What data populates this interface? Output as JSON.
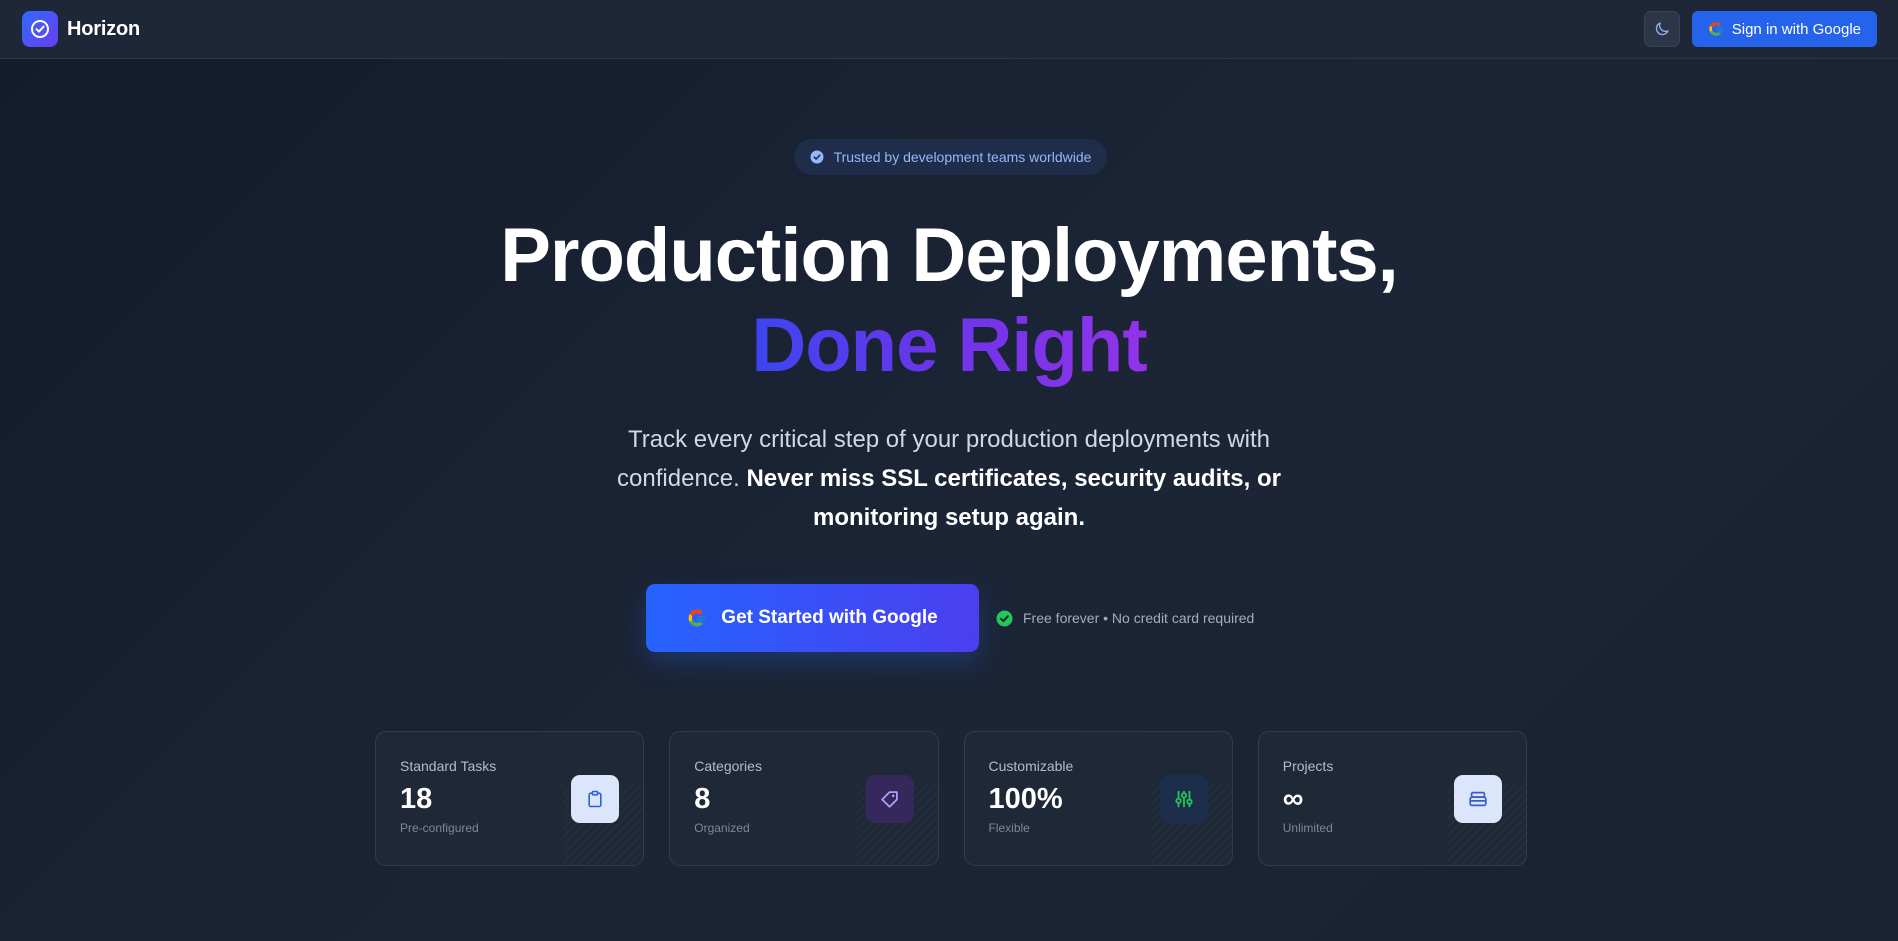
{
  "nav": {
    "brand": "Horizon",
    "signin_label": "Sign in with Google"
  },
  "hero": {
    "badge": "Trusted by development teams worldwide",
    "title_line1": "Production Deployments,",
    "title_line2": "Done Right",
    "subtitle_plain": "Track every critical step of your production deployments with confidence. ",
    "subtitle_bold": "Never miss SSL certificates, security audits, or monitoring setup again.",
    "cta_label": "Get Started with Google",
    "free_note": "Free forever • No credit card required"
  },
  "stats": [
    {
      "label": "Standard Tasks",
      "value": "18",
      "caption": "Pre-configured",
      "icon": "clipboard-icon",
      "icon_bg": "#dbe6fb",
      "icon_color": "#2f5fd4"
    },
    {
      "label": "Categories",
      "value": "8",
      "caption": "Organized",
      "icon": "tag-icon",
      "icon_bg": "#35285c",
      "icon_color": "#b79cff"
    },
    {
      "label": "Customizable",
      "value": "100%",
      "caption": "Flexible",
      "icon": "sliders-icon",
      "icon_bg": "#1d2e4a",
      "icon_color": "#22c55e"
    },
    {
      "label": "Projects",
      "value": "∞",
      "caption": "Unlimited",
      "icon": "layers-icon",
      "icon_bg": "#dbe6fb",
      "icon_color": "#3a5fc8"
    }
  ],
  "colors": {
    "primary": "#2563eb",
    "accent_purple": "#9333ea",
    "success": "#22c55e",
    "badge_text": "#93b8ff"
  }
}
